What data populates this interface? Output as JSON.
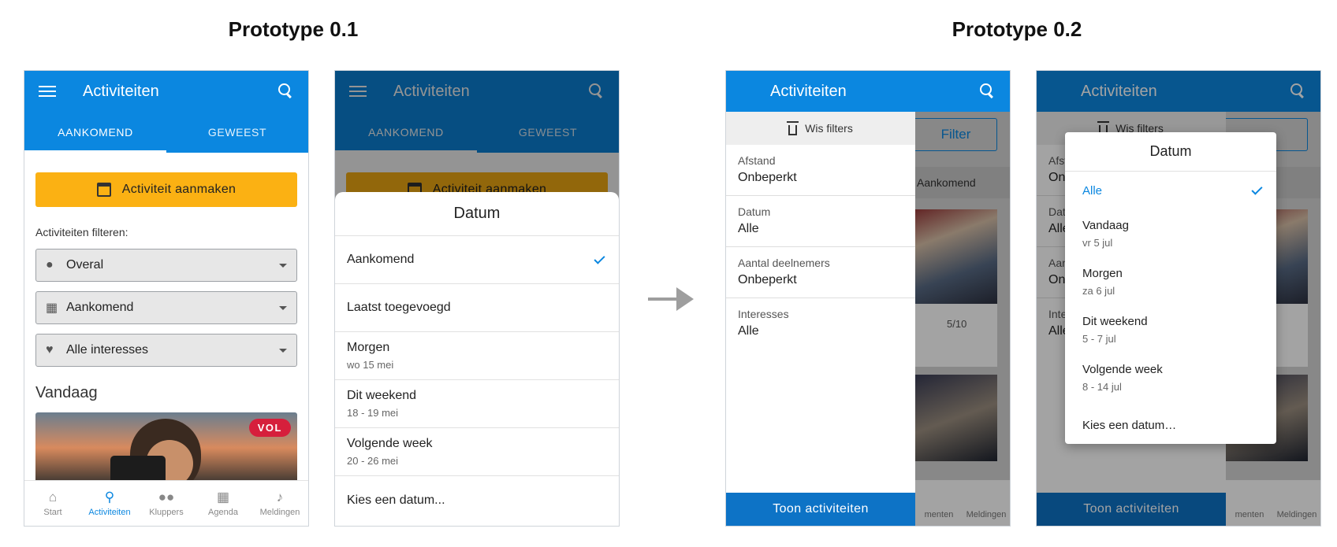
{
  "titles": {
    "left": "Prototype 0.1",
    "right": "Prototype 0.2"
  },
  "p1": {
    "appbar_title": "Activiteiten",
    "tabs": [
      "AANKOMEND",
      "GEWEEST"
    ],
    "create_btn": "Activiteit aanmaken",
    "filter_label": "Activiteiten filteren:",
    "selects": [
      {
        "icon": "location-icon",
        "value": "Overal"
      },
      {
        "icon": "calendar-icon",
        "value": "Aankomend"
      },
      {
        "icon": "heart-icon",
        "value": "Alle interesses"
      }
    ],
    "section": "Vandaag",
    "badge": "VOL",
    "nav": [
      {
        "icon": "home-icon",
        "label": "Start"
      },
      {
        "icon": "search-icon",
        "label": "Activiteiten"
      },
      {
        "icon": "people-icon",
        "label": "Kluppers"
      },
      {
        "icon": "calendar-icon",
        "label": "Agenda"
      },
      {
        "icon": "bell-icon",
        "label": "Meldingen"
      }
    ]
  },
  "p2": {
    "sheet_title": "Datum",
    "options": [
      {
        "label": "Aankomend",
        "sub": "",
        "selected": true
      },
      {
        "label": "Laatst toegevoegd",
        "sub": ""
      },
      {
        "label": "Morgen",
        "sub": "wo 15 mei"
      },
      {
        "label": "Dit weekend",
        "sub": "18 - 19 mei"
      },
      {
        "label": "Volgende week",
        "sub": "20 - 26 mei"
      },
      {
        "label": "Kies een datum...",
        "sub": ""
      }
    ]
  },
  "p3": {
    "appbar_title": "Activiteiten",
    "clear_filters": "Wis filters",
    "filters": [
      {
        "key": "Afstand",
        "value": "Onbeperkt"
      },
      {
        "key": "Datum",
        "value": "Alle"
      },
      {
        "key": "Aantal deelnemers",
        "value": "Onbeperkt"
      },
      {
        "key": "Interesses",
        "value": "Alle"
      }
    ],
    "show_btn": "Toon activiteiten",
    "bg_filter_btn": "Filter",
    "bg_sort": "Aankomend",
    "bg_count": "5/10",
    "bg_nav": [
      "menten",
      "Meldingen"
    ]
  },
  "p4": {
    "dialog_title": "Datum",
    "options": [
      {
        "label": "Alle",
        "sub": "",
        "selected": true
      },
      {
        "label": "Vandaag",
        "sub": "vr 5 jul"
      },
      {
        "label": "Morgen",
        "sub": "za 6 jul"
      },
      {
        "label": "Dit weekend",
        "sub": "5 - 7 jul"
      },
      {
        "label": "Volgende week",
        "sub": "8 - 14 jul"
      },
      {
        "label": "Kies een datum…",
        "sub": ""
      }
    ]
  },
  "colors": {
    "primary": "#0b87e0",
    "accent": "#fbb113",
    "danger": "#d61f3c",
    "button": "#0d73c6"
  }
}
